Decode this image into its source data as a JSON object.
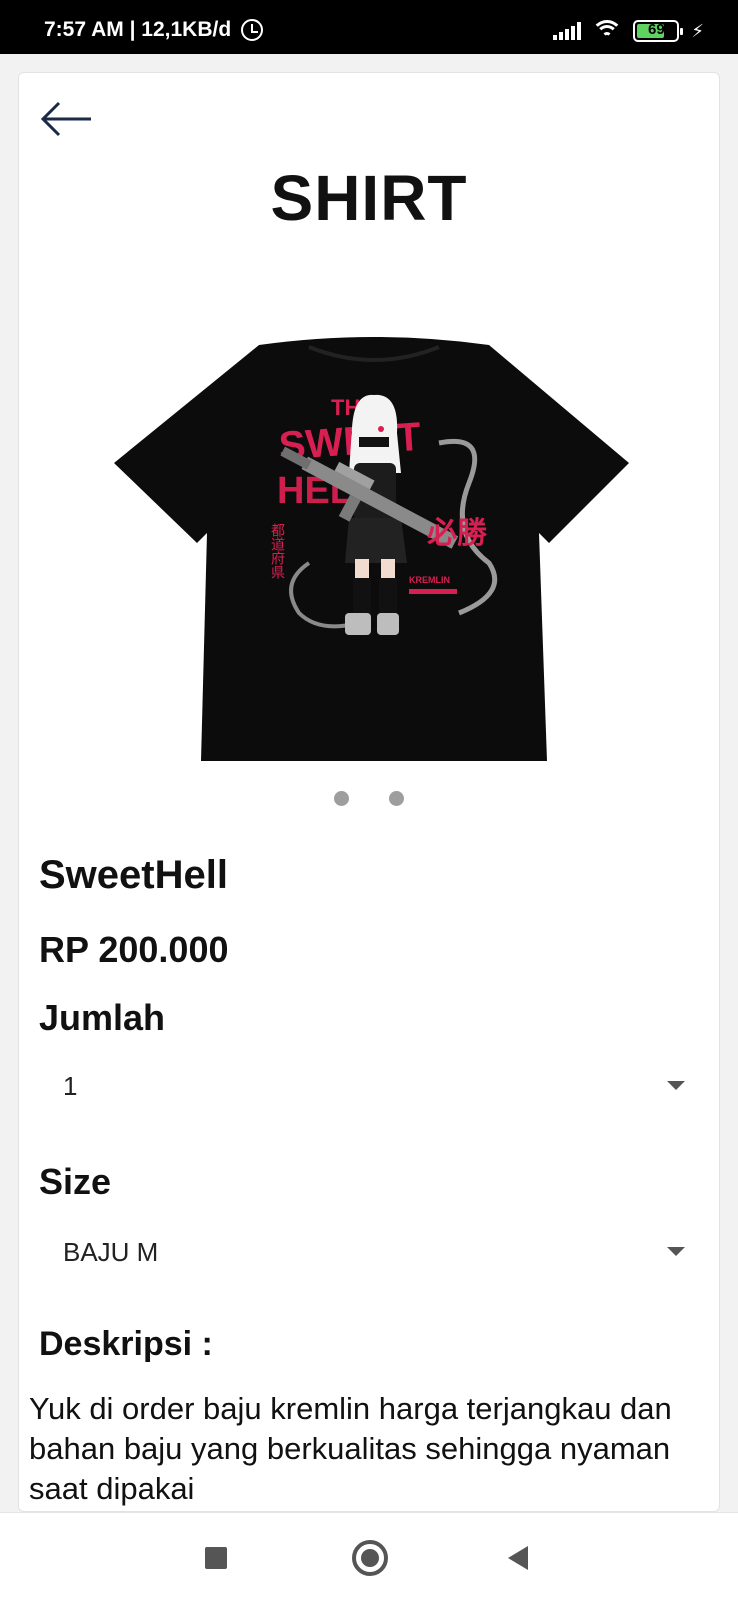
{
  "status_bar": {
    "time_speed": "7:57 AM | 12,1KB/d",
    "battery_level": "69"
  },
  "header": {
    "title": "SHIRT"
  },
  "carousel": {
    "slide_count": 2,
    "current": 1,
    "shirt_print": {
      "line1": "THE",
      "line2": "SWEET",
      "line3": "HELL",
      "kanji_left": "都道府県",
      "kanji_right": "必勝",
      "brand": "KREMLIN"
    }
  },
  "product": {
    "name": "SweetHell",
    "price": "RP 200.000"
  },
  "quantity": {
    "label": "Jumlah",
    "value": "1"
  },
  "size": {
    "label": "Size",
    "value": "BAJU M"
  },
  "description": {
    "label": "Deskripsi :",
    "text": "Yuk di order baju kremlin harga terjangkau dan bahan baju yang berkualitas sehingga nyaman saat dipakai"
  },
  "colors": {
    "accent_print": "#d81f52",
    "shirt": "#0c0c0c",
    "nav_icons": "#555555"
  }
}
